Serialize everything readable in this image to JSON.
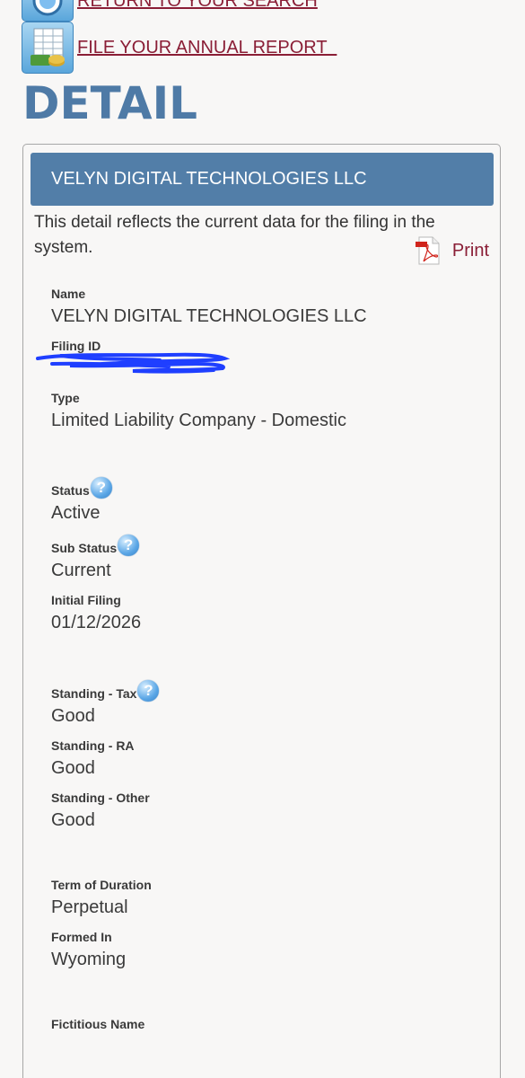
{
  "links": {
    "return_search": "RETURN TO YOUR SEARCH",
    "annual_report": "FILE YOUR ANNUAL REPORT  "
  },
  "page_title": "DETAIL",
  "panel": {
    "header": "VELYN DIGITAL TECHNOLOGIES LLC",
    "intro": "This detail reflects the current data for the filing in the system.",
    "print_label": "Print"
  },
  "fields": {
    "name": {
      "label": "Name",
      "value": "VELYN DIGITAL TECHNOLOGIES LLC"
    },
    "filing_id": {
      "label": "Filing ID"
    },
    "type": {
      "label": "Type",
      "value": "Limited Liability Company - Domestic"
    },
    "status": {
      "label": "Status",
      "value": "Active"
    },
    "sub_status": {
      "label": "Sub Status",
      "value": "Current"
    },
    "initial_filing": {
      "label": "Initial Filing",
      "value": "01/12/2026"
    },
    "standing_tax": {
      "label": "Standing - Tax",
      "value": "Good"
    },
    "standing_ra": {
      "label": "Standing - RA",
      "value": "Good"
    },
    "standing_other": {
      "label": "Standing - Other",
      "value": "Good"
    },
    "term_of_duration": {
      "label": "Term of Duration",
      "value": "Perpetual"
    },
    "formed_in": {
      "label": "Formed In",
      "value": "Wyoming"
    },
    "fictitious_name": {
      "label": "Fictitious Name"
    }
  },
  "help_glyph": "?",
  "colors": {
    "link": "#8a1e36",
    "title": "#4e7aa6",
    "header_bg": "#527ea8",
    "redaction": "#1f3fff"
  },
  "icons": [
    "search-return-icon",
    "spreadsheet-report-icon",
    "pdf-icon",
    "help-icon"
  ]
}
